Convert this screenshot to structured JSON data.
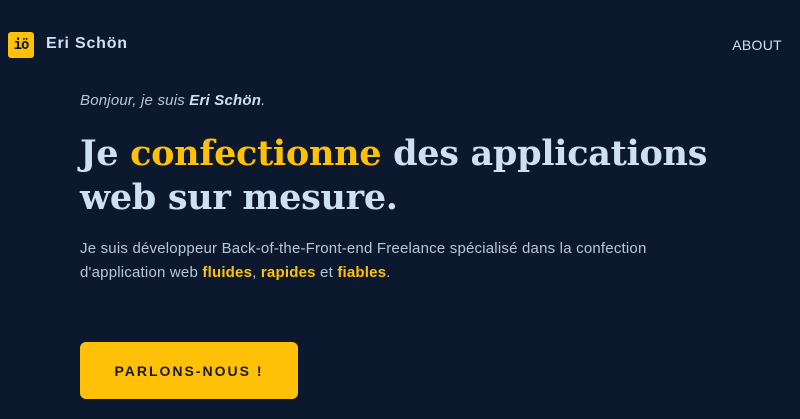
{
  "header": {
    "logo_text": "iö",
    "brand_name": "Eri Schön",
    "nav": [
      {
        "label": "ABOUT"
      }
    ]
  },
  "hero": {
    "greeting_prefix": "Bonjour, je suis ",
    "greeting_name": "Eri Schön",
    "greeting_suffix": ".",
    "headline_part1": "Je ",
    "headline_accent": "confectionne",
    "headline_part2": " des applications web sur mesure.",
    "intro_part1": "Je suis développeur Back-of-the-Front-end Freelance spécialisé dans la confection d'application web ",
    "intro_hl1": "fluides",
    "intro_sep1": ", ",
    "intro_hl2": "rapides",
    "intro_sep2": " et ",
    "intro_hl3": "fiables",
    "intro_end": ".",
    "cta_label": "PARLONS-NOUS !"
  },
  "colors": {
    "background": "#0c182e",
    "accent": "#ffc107",
    "text_primary": "#cfe0f5",
    "text_secondary": "#b7c6dc"
  }
}
